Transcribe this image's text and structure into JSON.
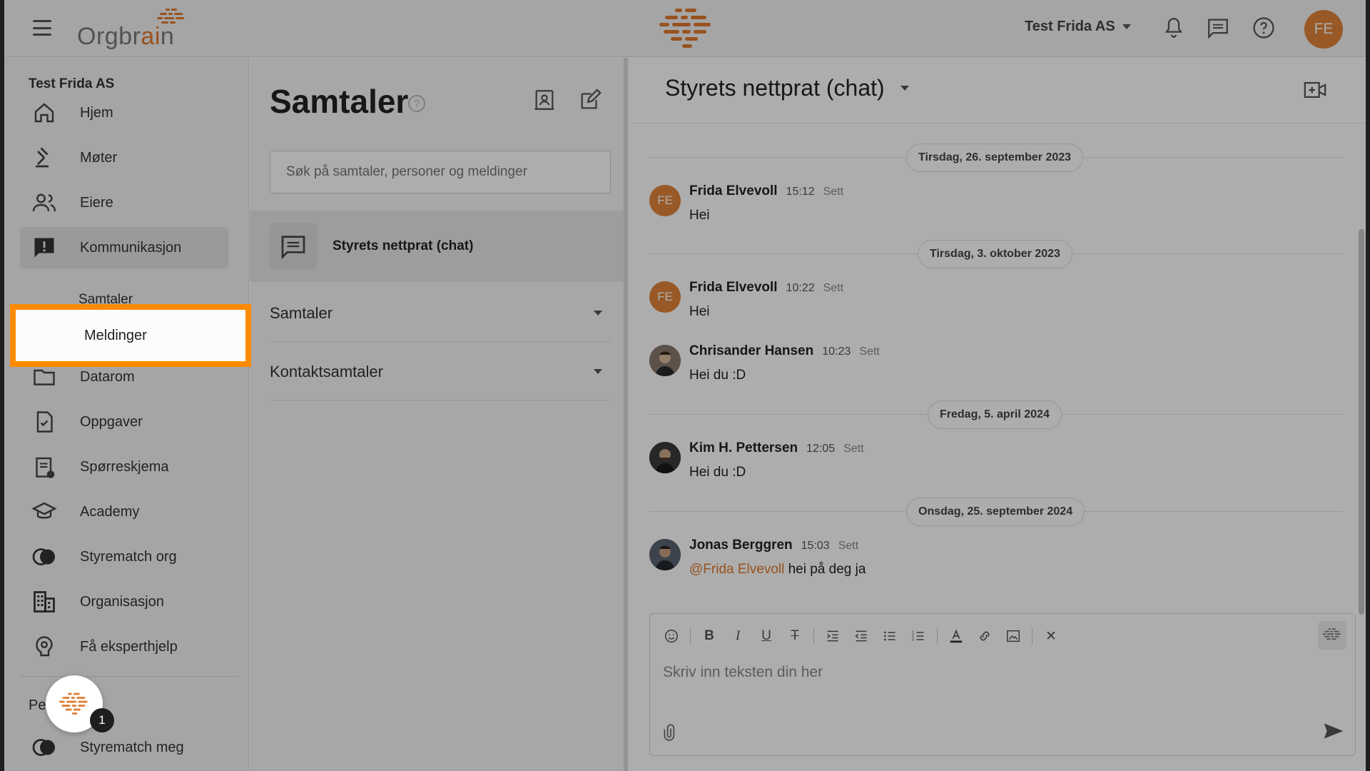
{
  "topbar": {
    "logo_text_main": "Orgbr",
    "logo_text_accent": "ai",
    "logo_text_end": "n",
    "org_name": "Test Frida AS",
    "user_initials": "FE"
  },
  "sidebar": {
    "company": "Test Frida AS",
    "items": [
      {
        "label": "Hjem",
        "icon": "home-icon"
      },
      {
        "label": "Møter",
        "icon": "gavel-icon"
      },
      {
        "label": "Eiere",
        "icon": "people-icon"
      },
      {
        "label": "Kommunikasjon",
        "icon": "alert-message-icon"
      },
      {
        "label": "Datarom",
        "icon": "folder-icon"
      },
      {
        "label": "Oppgaver",
        "icon": "task-icon"
      },
      {
        "label": "Spørreskjema",
        "icon": "survey-icon"
      },
      {
        "label": "Academy",
        "icon": "graduation-cap-icon"
      },
      {
        "label": "Styrematch org",
        "icon": "toggle-circles-icon"
      },
      {
        "label": "Organisasjon",
        "icon": "building-icon"
      },
      {
        "label": "Få eksperthjelp",
        "icon": "expert-help-icon"
      }
    ],
    "sub_items": [
      "Samtaler",
      "Meldinger"
    ],
    "personal_label": "Pe",
    "personal_item": "Styrematch meg",
    "chat_badge": "1"
  },
  "middle": {
    "title": "Samtaler",
    "help": "?",
    "search_placeholder": "Søk på samtaler, personer og meldinger",
    "active_conversation": "Styrets nettprat (chat)",
    "sections": [
      "Samtaler",
      "Kontaktsamtaler"
    ]
  },
  "chat": {
    "title": "Styrets nettprat (chat)",
    "dates": [
      "Tirsdag, 26. september 2023",
      "Tirsdag, 3. oktober 2023",
      "Fredag, 5. april 2024",
      "Onsdag, 25. september 2024"
    ],
    "messages": [
      {
        "name": "Frida Elvevoll",
        "time": "15:12",
        "seen": "Sett",
        "text": "Hei",
        "initials": "FE"
      },
      {
        "name": "Frida Elvevoll",
        "time": "10:22",
        "seen": "Sett",
        "text": "Hei",
        "initials": "FE"
      },
      {
        "name": "Chrisander Hansen",
        "time": "10:23",
        "seen": "Sett",
        "text": "Hei du :D"
      },
      {
        "name": "Kim H. Pettersen",
        "time": "12:05",
        "seen": "Sett",
        "text": "Hei du :D"
      },
      {
        "name": "Jonas Berggren",
        "time": "15:03",
        "seen": "Sett",
        "mention": "@Frida Elvevoll",
        "text": " hei på deg ja"
      }
    ],
    "composer_placeholder": "Skriv inn teksten din her"
  },
  "colors": {
    "accent": "#e07a2e",
    "highlight": "#ff8a00",
    "overlay": "rgba(0,0,0,0.32)"
  }
}
